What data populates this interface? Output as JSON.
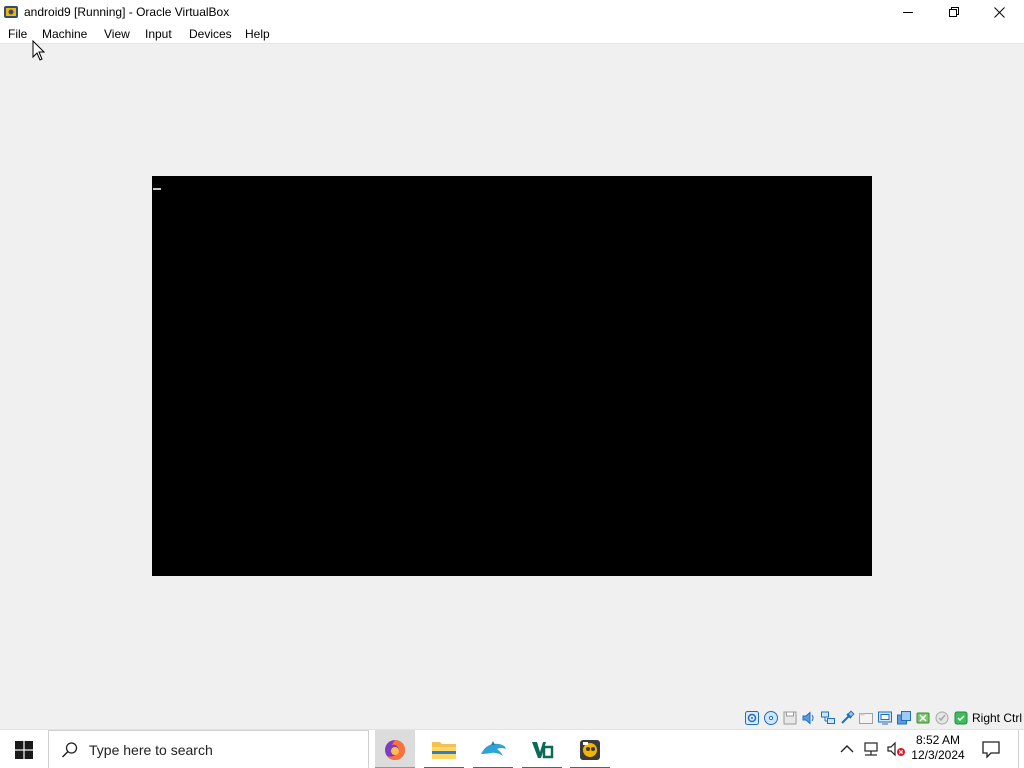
{
  "window": {
    "title": "android9 [Running] - Oracle VirtualBox",
    "app_icon": "virtualbox-icon",
    "controls": [
      "minimize-icon",
      "restore-icon",
      "close-icon"
    ]
  },
  "menubar": {
    "items": [
      {
        "label": "File"
      },
      {
        "label": "Machine"
      },
      {
        "label": "View"
      },
      {
        "label": "Input"
      },
      {
        "label": "Devices"
      },
      {
        "label": "Help"
      }
    ]
  },
  "vm": {
    "screen_color": "#000000",
    "cursor": "_"
  },
  "statusbar": {
    "icons": [
      "hard-disk-icon",
      "optical-drive-icon",
      "floppy-icon",
      "audio-icon",
      "network-icon",
      "usb-icon",
      "shared-folders-icon",
      "display-icon",
      "video-capture-icon",
      "recording-icon",
      "guest-additions-icon",
      "cpu-icon",
      "mouse-integration-icon"
    ],
    "host_key": "Right Ctrl"
  },
  "taskbar": {
    "search_placeholder": "Type here to search",
    "apps": [
      {
        "name": "firefox-icon",
        "active": true
      },
      {
        "name": "file-explorer-icon",
        "active": false
      },
      {
        "name": "dolphin-icon",
        "active": false
      },
      {
        "name": "visual-studio-code-icon",
        "active": false
      },
      {
        "name": "virtualbox-icon",
        "active": false
      }
    ],
    "clock": {
      "time": "8:52 AM",
      "date": "12/3/2024"
    }
  },
  "colors": {
    "accent": "#0078d4",
    "titlebar": "#ffffff",
    "window_bg": "#f0f0f0"
  }
}
